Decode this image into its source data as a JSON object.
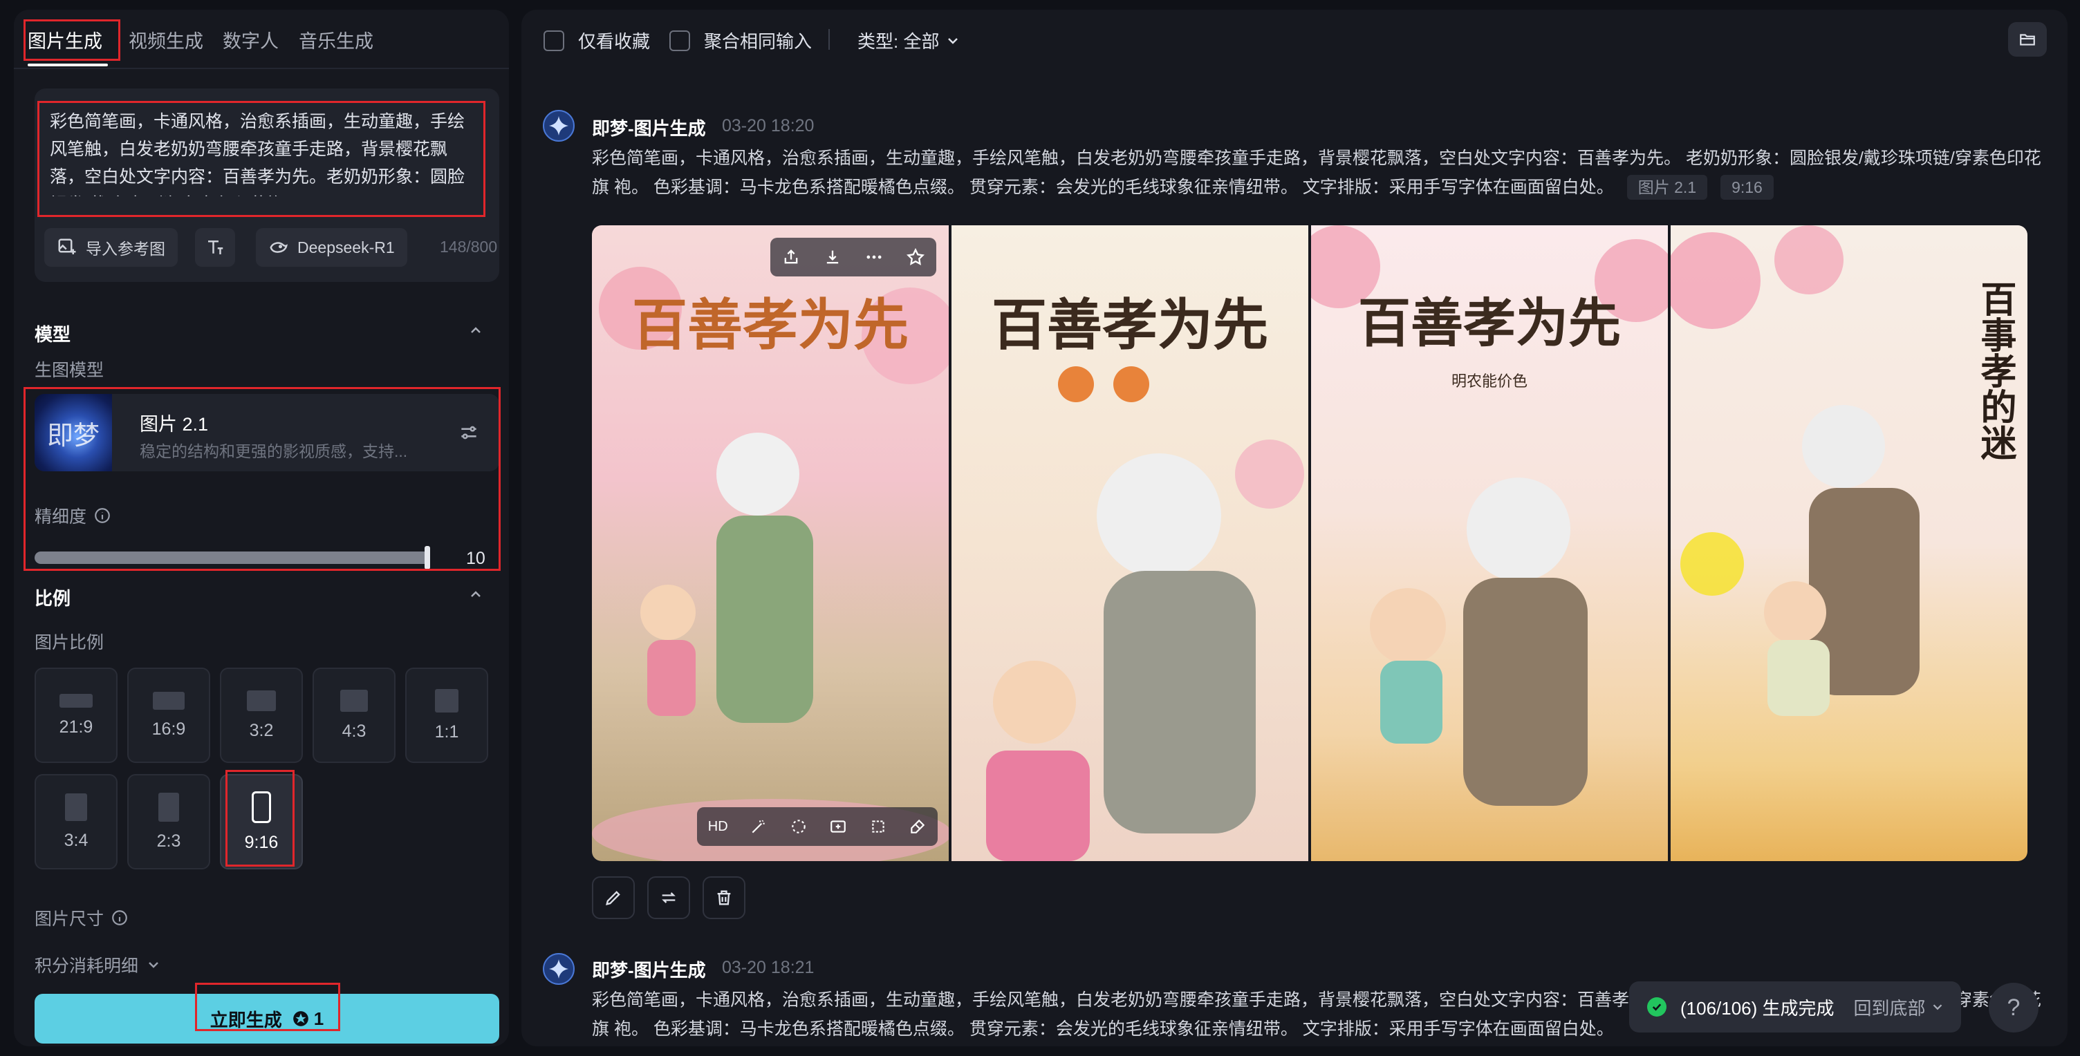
{
  "left": {
    "tabs": [
      "图片生成",
      "视频生成",
      "数字人",
      "音乐生成"
    ],
    "prompt": {
      "text": "彩色简笔画，卡通风格，治愈系插画，生动童趣，手绘风笔触，白发老奶奶弯腰牵孩童手走路，背景樱花飘落，空白处文字内容：百善孝为先。老奶奶形象：圆脸银发/戴珍珠项链/穿素色印花旗",
      "import_ref": "导入参考图",
      "model_chip": "Deepseek-R1",
      "count": "148/800"
    },
    "model_section": {
      "title": "模型",
      "sub": "生图模型",
      "thumb_text": "即梦",
      "name": "图片 2.1",
      "desc": "稳定的结构和更强的影视质感，支持...",
      "precision_label": "精细度",
      "precision_value": "10",
      "precision_fraction": 1.0
    },
    "ratio_section": {
      "title": "比例",
      "sub": "图片比例",
      "ratios": [
        "21:9",
        "16:9",
        "3:2",
        "4:3",
        "1:1",
        "3:4",
        "2:3",
        "9:16"
      ],
      "selected": "9:16"
    },
    "size_label": "图片尺寸",
    "cost_label": "积分消耗明细",
    "generate": {
      "label": "立即生成",
      "cost": "1"
    }
  },
  "right": {
    "filters": {
      "fav_only": "仅看收藏",
      "merge": "聚合相同输入",
      "type": "类型: 全部"
    },
    "messages": [
      {
        "author": "即梦-图片生成",
        "time": "03-20  18:20",
        "text": "彩色简笔画，卡通风格，治愈系插画，生动童趣，手绘风笔触，白发老奶奶弯腰牵孩童手走路，背景樱花飘落，空白处文字内容：百善孝为先。 老奶奶形象：圆脸银发/戴珍珠项链/穿素色印花旗 袍。 色彩基调：马卡龙色系搭配暖橘色点缀。 贯穿元素：会发光的毛线球象征亲情纽带。 文字排版：采用手写字体在画面留白处。",
        "tags": [
          "图片 2.1",
          "9:16"
        ],
        "image_titles": [
          "百善孝为先",
          "百善孝为先",
          "百善孝为先",
          "百事孝的迷"
        ],
        "image_sub": "明农能价色",
        "hd": "HD"
      },
      {
        "author": "即梦-图片生成",
        "time": "03-20  18:21",
        "text": "彩色简笔画，卡通风格，治愈系插画，生动童趣，手绘风笔触，白发老奶奶弯腰牵孩童手走路，背景樱花飘落，空白处文字内容：百善孝为先。 老奶奶形象：圆脸银发/戴珍珠项链/穿素色印花旗 袍。 色彩基调：马卡龙色系搭配暖橘色点缀。 贯穿元素：会发光的毛线球象征亲情纽带。 文字排版：采用手写字体在画面留白处。"
      }
    ],
    "toast": {
      "status": "(106/106) 生成完成",
      "back": "回到底部"
    },
    "help": "?"
  },
  "colors": {
    "accent": "#5ccfe3",
    "highlight": "#e0262b",
    "success": "#22c55e"
  }
}
